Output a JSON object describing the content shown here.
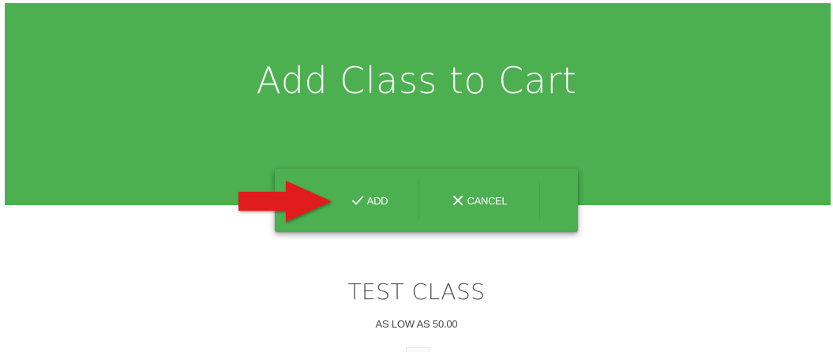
{
  "header": {
    "title": "Add Class to Cart",
    "background_color": "#4caf50"
  },
  "actions": {
    "add_label": "ADD",
    "add_icon": "check-icon",
    "cancel_label": "CANCEL",
    "cancel_icon": "close-icon"
  },
  "annotation": {
    "arrow_color": "#e01b1b",
    "arrow_icon": "arrow-right-icon"
  },
  "product": {
    "name": "TEST CLASS",
    "price_text": "AS LOW AS 50.00"
  }
}
